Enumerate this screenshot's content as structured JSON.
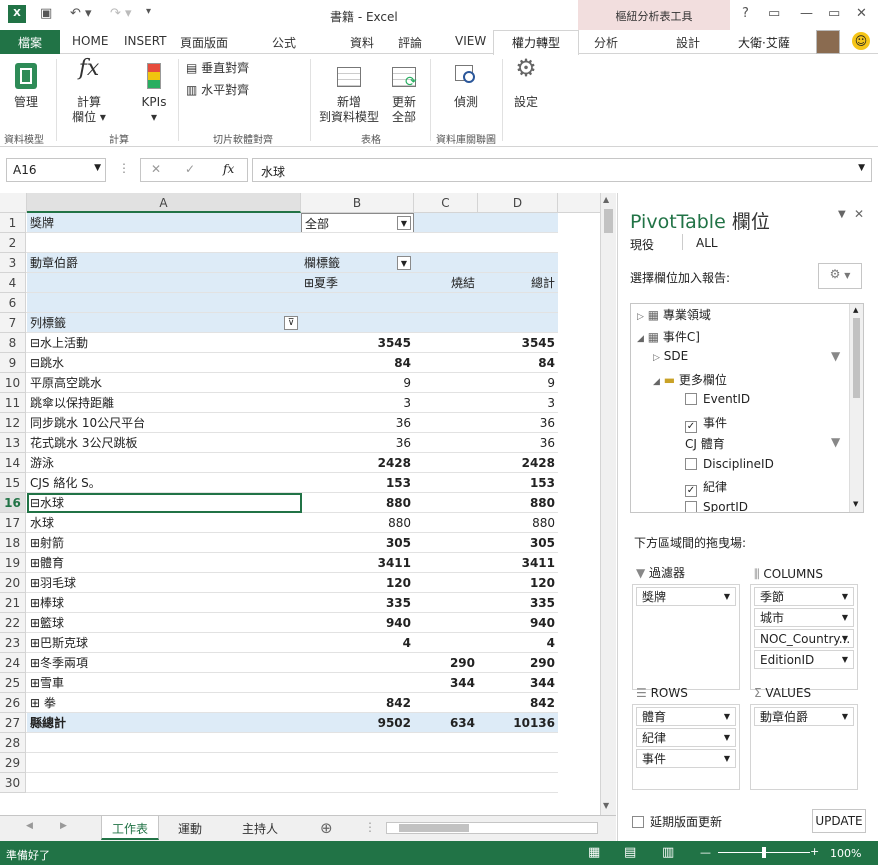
{
  "titlebar": {
    "title": "書籍 - Excel",
    "pivot_tools": "樞紐分析表工具",
    "help": "?",
    "restore": "▭",
    "minimize": "—",
    "close": "✕"
  },
  "tabs": {
    "file": "檔案",
    "home": "HOME",
    "insert": "INSERT",
    "layout": "頁面版面",
    "formulas": "公式",
    "data": "資料",
    "review": "評論",
    "view": "VIEW",
    "power": "權力轉型",
    "analyze": "分析",
    "design": "設計",
    "user": "大衛·艾薩"
  },
  "ribbon": {
    "manage": "管理",
    "calc": "計算",
    "calc2": "欄位",
    "kpis": "KPIs",
    "valign": "垂直對齊",
    "halign": "水平對齊",
    "add": "新增",
    "add2": "到資料模型",
    "refresh": "更新",
    "refresh2": "全部",
    "detect": "偵測",
    "settings": "設定",
    "g_model": "資料模型",
    "g_calc": "計算",
    "g_slicer": "切片軟體對齊",
    "g_table": "表格",
    "g_rel": "資料庫關聯圖"
  },
  "formula": {
    "namebox": "A16",
    "cancel": "✕",
    "enter": "✓",
    "fx": "fx",
    "value": "水球"
  },
  "columns": {
    "a": "A",
    "b": "B",
    "c": "C",
    "d": "D"
  },
  "rows": [
    {
      "n": "1",
      "a": "獎牌",
      "b": "全部",
      "c": "",
      "d": "",
      "style": "filter"
    },
    {
      "n": "2",
      "a": "",
      "b": "",
      "c": "",
      "d": "",
      "style": ""
    },
    {
      "n": "3",
      "a": "動章伯爵",
      "b": "欄標籤",
      "c": "",
      "d": "",
      "style": "hdr"
    },
    {
      "n": "4",
      "a": "",
      "b": "⊞夏季",
      "c": "燒結",
      "d": "總計",
      "style": "hdr"
    },
    {
      "n": "6",
      "a": "",
      "b": "",
      "c": "",
      "d": "",
      "style": "hdr"
    },
    {
      "n": "7",
      "a": "列標籤",
      "b": "",
      "c": "",
      "d": "",
      "style": "hdr"
    },
    {
      "n": "8",
      "a": "⊟水上活動",
      "b": "3545",
      "c": "",
      "d": "3545",
      "style": "bold"
    },
    {
      "n": "9",
      "a": "  ⊟跳水",
      "b": "84",
      "c": "",
      "d": "84",
      "style": "bold"
    },
    {
      "n": "10",
      "a": "        平原高空跳水",
      "b": "9",
      "c": "",
      "d": "9",
      "style": ""
    },
    {
      "n": "11",
      "a": "        跳傘以保持距離",
      "b": "3",
      "c": "",
      "d": "3",
      "style": ""
    },
    {
      "n": "12",
      "a": "        同步跳水 10公尺平台",
      "b": "36",
      "c": "",
      "d": "36",
      "style": ""
    },
    {
      "n": "13",
      "a": "        花式跳水 3公尺跳板",
      "b": "36",
      "c": "",
      "d": "36",
      "style": ""
    },
    {
      "n": "14",
      "a": "    游泳",
      "b": "2428",
      "c": "",
      "d": "2428",
      "style": "bold"
    },
    {
      "n": "15",
      "a": "    CJS 絡化 S。",
      "b": "153",
      "c": "",
      "d": "153",
      "style": "bold"
    },
    {
      "n": "16",
      "a": "  ⊟水球",
      "b": "880",
      "c": "",
      "d": "880",
      "style": "bold"
    },
    {
      "n": "17",
      "a": "        水球",
      "b": "880",
      "c": "",
      "d": "880",
      "style": ""
    },
    {
      "n": "18",
      "a": "⊞射箭",
      "b": "305",
      "c": "",
      "d": "305",
      "style": "bold"
    },
    {
      "n": "19",
      "a": "⊞體育",
      "b": "3411",
      "c": "",
      "d": "3411",
      "style": "bold"
    },
    {
      "n": "20",
      "a": "⊞羽毛球",
      "b": "120",
      "c": "",
      "d": "120",
      "style": "bold"
    },
    {
      "n": "21",
      "a": "⊞棒球",
      "b": "335",
      "c": "",
      "d": "335",
      "style": "bold"
    },
    {
      "n": "22",
      "a": "⊞籃球",
      "b": "940",
      "c": "",
      "d": "940",
      "style": "bold"
    },
    {
      "n": "23",
      "a": "⊞巴斯克球",
      "b": "4",
      "c": "",
      "d": "4",
      "style": "bold"
    },
    {
      "n": "24",
      "a": "⊞冬季兩項",
      "b": "",
      "c": "290",
      "d": "290",
      "style": "bold"
    },
    {
      "n": "25",
      "a": "⊞雪車",
      "b": "",
      "c": "344",
      "d": "344",
      "style": "bold"
    },
    {
      "n": "26",
      "a": "⊞        拳",
      "b": "842",
      "c": "",
      "d": "842",
      "style": "bold"
    },
    {
      "n": "27",
      "a": "    縣總計",
      "b": "9502",
      "c": "634",
      "d": "10136",
      "style": "total"
    },
    {
      "n": "28",
      "a": "",
      "b": "",
      "c": "",
      "d": "",
      "style": ""
    },
    {
      "n": "29",
      "a": "",
      "b": "",
      "c": "",
      "d": "",
      "style": ""
    },
    {
      "n": "30",
      "a": "",
      "b": "",
      "c": "",
      "d": "",
      "style": ""
    }
  ],
  "sheettabs": [
    "工作表",
    "運動",
    "主持人"
  ],
  "status": {
    "ready": "準備好了",
    "zoom": "100%",
    "minus": "—",
    "plus": "+"
  },
  "pane": {
    "title": "PivotTable",
    "title2": "欄位",
    "tab_active": "現役",
    "tab_all": "ALL",
    "choose": "選擇欄位加入報告:",
    "fields": [
      {
        "label": "專業領域",
        "kind": "table",
        "checked": false
      },
      {
        "label": "事件C]",
        "kind": "table",
        "checked": false
      },
      {
        "label": "SDE",
        "kind": "sub",
        "checked": false
      },
      {
        "label": "更多欄位",
        "kind": "folder",
        "checked": false
      },
      {
        "label": "EventID",
        "kind": "check",
        "checked": false
      },
      {
        "label": "事件",
        "kind": "check",
        "checked": true
      },
      {
        "label": "CJ 體育",
        "kind": "plain",
        "checked": false
      },
      {
        "label": "DisciplineID",
        "kind": "check",
        "checked": false
      },
      {
        "label": "紀律",
        "kind": "check",
        "checked": true
      },
      {
        "label": "SportID",
        "kind": "check",
        "checked": false
      }
    ],
    "drag": "下方區域間的拖曳場:",
    "filters_label": "過濾器",
    "columns_label": "COLUMNS",
    "rows_label": "ROWS",
    "values_label": "VALUES",
    "filters": [
      "獎牌"
    ],
    "columns": [
      "季節",
      "城市",
      "NOC_Country...",
      "EditionID"
    ],
    "rows": [
      "體育",
      "紀律",
      "事件"
    ],
    "values": [
      "動章伯爵"
    ],
    "defer": "延期版面更新",
    "update": "UPDATE"
  }
}
